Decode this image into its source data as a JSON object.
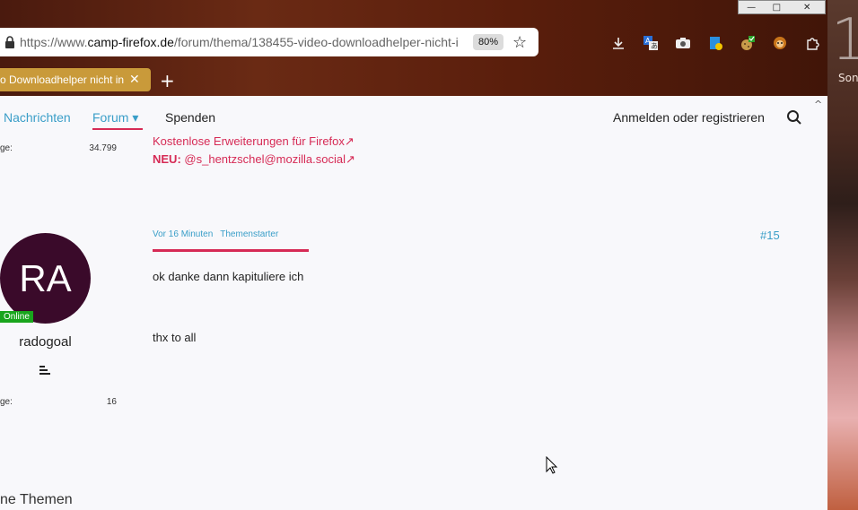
{
  "desktop": {
    "clock_digit": "1",
    "side_label": "Son"
  },
  "window_controls": {
    "minimize": "—",
    "maximize": "□",
    "close": "✕"
  },
  "browser": {
    "url_prefix": "https://www.",
    "url_domain": "camp-firefox.de",
    "url_path": "/forum/thema/138455-video-downloadhelper-nicht-i",
    "zoom": "80%",
    "tab_title": "o Downloadhelper nicht in",
    "tab_close": "✕",
    "new_tab": "+"
  },
  "nav": {
    "nachrichten": "Nachrichten",
    "forum": "Forum",
    "forum_caret": "▾",
    "spenden": "Spenden",
    "login": "Anmelden oder registrieren"
  },
  "stats": {
    "prev_label": "ge:",
    "prev_value": "34.799",
    "user_label": "ge:",
    "user_value": "16"
  },
  "signature": {
    "line1": "Kostenlose Erweiterungen für Firefox↗",
    "line2_prefix": "NEU:",
    "line2_handle": "@s_hentzschel@mozilla.social↗"
  },
  "post": {
    "time": "Vor 16 Minuten",
    "role": "Themenstarter",
    "number": "#15",
    "text1": "ok danke dann kapituliere ich",
    "text2": "thx to all"
  },
  "author": {
    "initials": "RA",
    "status": "Online",
    "name": "radogoal"
  },
  "section": {
    "title": "ne Themen"
  },
  "colors": {
    "accent_blue": "#3a9ec8",
    "accent_red": "#d62a55",
    "tab_active": "#c99a3a",
    "avatar_bg": "#3a0a2a",
    "online_green": "#19a51d"
  }
}
